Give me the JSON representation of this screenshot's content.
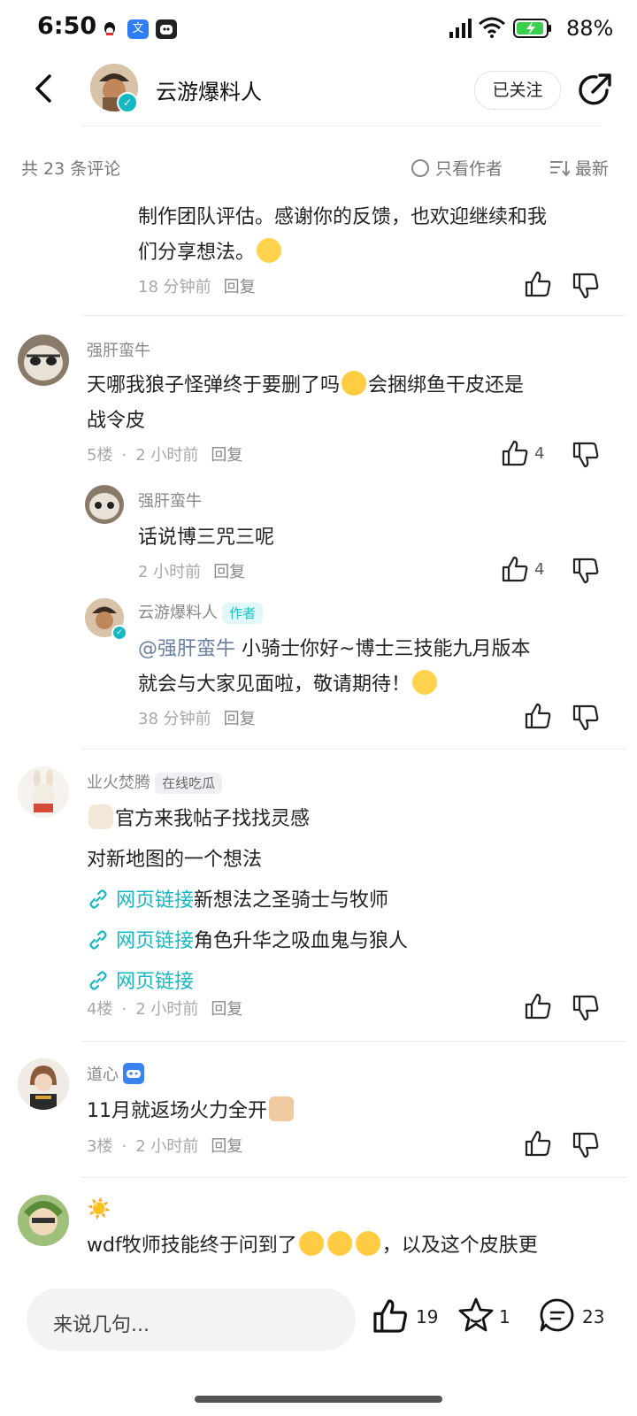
{
  "status_bar": {
    "time": "6:50",
    "battery": "88%"
  },
  "header": {
    "author_name": "云游爆料人",
    "follow_label": "已关注"
  },
  "filter": {
    "count_text": "共 23 条评论",
    "author_only": "只看作者",
    "sort": "最新"
  },
  "comments": [
    {
      "id": "c0",
      "text_lines": [
        "制作团队评估。感谢你的反馈，也欢迎继续和我",
        "们分享想法。"
      ],
      "time": "18 分钟前",
      "reply": "回复"
    },
    {
      "id": "c1",
      "user": "强肝蛮牛",
      "text_lines": [
        "天哪我狼子怪弹终于要删了吗",
        "会捆绑鱼干皮还是",
        "战令皮"
      ],
      "floor": "5楼",
      "time": "2 小时前",
      "reply": "回复",
      "likes": "4",
      "replies": [
        {
          "user": "强肝蛮牛",
          "text": "话说博三咒三呢",
          "time": "2 小时前",
          "reply": "回复",
          "likes": "4"
        },
        {
          "user": "云游爆料人",
          "tag": "作者",
          "mention": "@强肝蛮牛",
          "text_lines": [
            "小骑士你好~博士三技能九月版本",
            "就会与大家见面啦，敬请期待！"
          ],
          "time": "38 分钟前",
          "reply": "回复"
        }
      ]
    },
    {
      "id": "c2",
      "user": "业火焚腾",
      "tag": "在线吃瓜",
      "line1": "官方来我帖子找找灵感",
      "line2": "对新地图的一个想法",
      "links": [
        {
          "label": "网页链接",
          "text": "新想法之圣骑士与牧师"
        },
        {
          "label": "网页链接",
          "text": "角色升华之吸血鬼与狼人"
        },
        {
          "label": "网页链接",
          "text": ""
        }
      ],
      "floor": "4楼",
      "time": "2 小时前",
      "reply": "回复"
    },
    {
      "id": "c3",
      "user": "道心",
      "text": "11月就返场火力全开",
      "floor": "3楼",
      "time": "2 小时前",
      "reply": "回复"
    },
    {
      "id": "c4",
      "user": "☀️",
      "text_a": "wdf牧师技能终于问到了",
      "text_b": "，以及这个皮肤更"
    }
  ],
  "bottom_bar": {
    "input_placeholder": "来说几句...",
    "like_count": "19",
    "fav_count": "1",
    "comment_count": "23"
  },
  "colors": {
    "accent": "#15b8c0",
    "verified": "#17b8c4"
  }
}
